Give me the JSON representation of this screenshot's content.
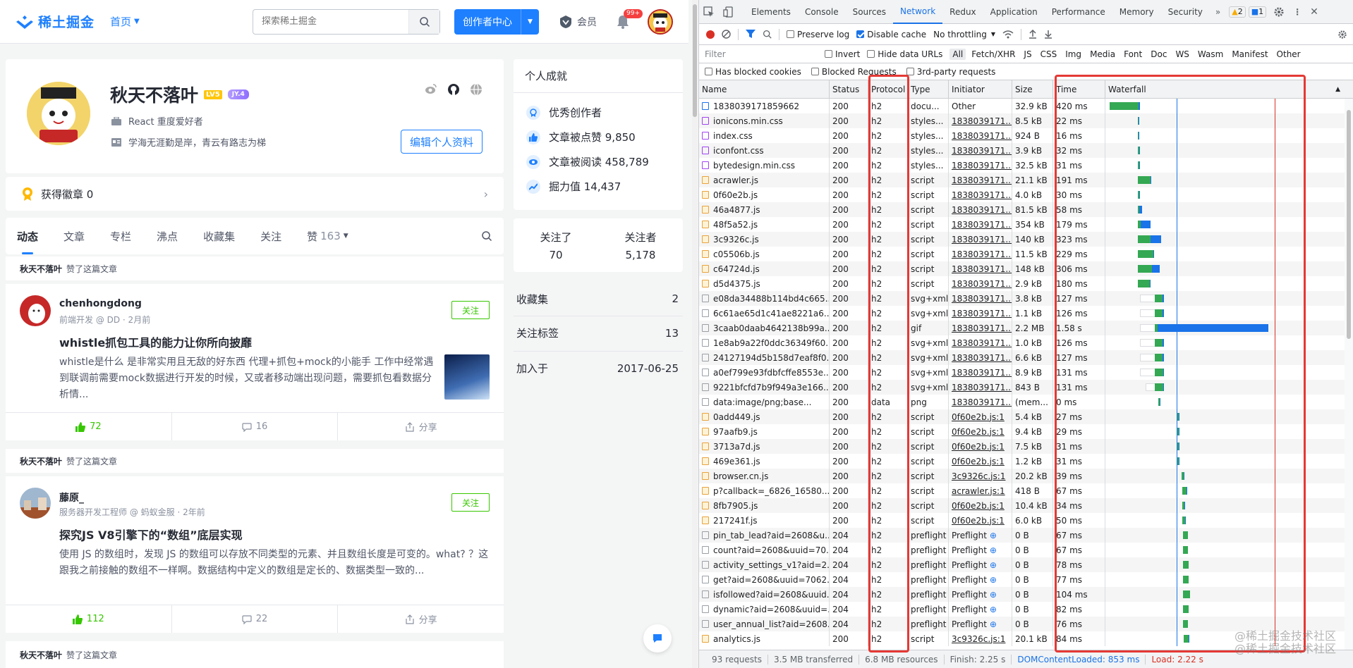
{
  "site": {
    "logo_text": "稀土掘金",
    "nav_home": "首页",
    "search_placeholder": "探索稀土掘金",
    "creator_btn": "创作者中心",
    "vip": "会员",
    "notif_badge": "99+",
    "brand_color": "#1e80ff"
  },
  "profile": {
    "name": "秋天不落叶",
    "level": "LV5",
    "jy": "JY.4",
    "title": "React 重度爱好者",
    "motto": "学海无涯勤是岸，青云有路志为梯",
    "edit_btn": "编辑个人资料",
    "badges_label": "获得徽章 0"
  },
  "tabs": [
    {
      "label": "动态"
    },
    {
      "label": "文章"
    },
    {
      "label": "专栏"
    },
    {
      "label": "沸点"
    },
    {
      "label": "收藏集"
    },
    {
      "label": "关注"
    },
    {
      "label": "赞",
      "count": "163"
    }
  ],
  "feed": [
    {
      "header_user": "秋天不落叶",
      "header_action": "赞了这篇文章",
      "author": "chenhongdong",
      "meta": "前端开发 @ DD · 2月前",
      "follow": "关注",
      "title": "whistle抓包工具的能力让你所向披靡",
      "body": "whistle是什么 是非常实用且无敌的好东西 代理+抓包+mock的小能手 工作中经常遇到联调前需要mock数据进行开发的时候，又或者移动端出现问题，需要抓包看数据分析情...",
      "likes": "72",
      "comments": "16",
      "share": "分享"
    },
    {
      "header_user": "秋天不落叶",
      "header_action": "赞了这篇文章",
      "author": "藤原_",
      "meta": "服务器开发工程师 @ 蚂蚁金服 · 2年前",
      "follow": "关注",
      "title": "探究JS V8引擎下的“数组”底层实现",
      "body": "使用 JS 的数组时，发现 JS 的数组可以存放不同类型的元素、并且数组长度是可变的。what? ？这跟我之前接触的数组不一样啊。数据结构中定义的数组是定长的、数据类型一致的...",
      "likes": "112",
      "comments": "22",
      "share": "分享"
    },
    {
      "header_user": "秋天不落叶",
      "header_action": "赞了这篇文章"
    }
  ],
  "achievements": {
    "title": "个人成就",
    "items": [
      {
        "text": "优秀创作者",
        "icon": "badge-icon"
      },
      {
        "text": "文章被点赞 9,850",
        "icon": "thumb-icon"
      },
      {
        "text": "文章被阅读 458,789",
        "icon": "eye-icon"
      },
      {
        "text": "掘力值 14,437",
        "icon": "trend-icon"
      }
    ]
  },
  "follows": {
    "following_label": "关注了",
    "following": "70",
    "followers_label": "关注者",
    "followers": "5,178"
  },
  "side_items": [
    {
      "label": "收藏集",
      "value": "2"
    },
    {
      "label": "关注标签",
      "value": "13"
    },
    {
      "label": "加入于",
      "value": "2017-06-25"
    }
  ],
  "devtools": {
    "tabs": [
      "Elements",
      "Console",
      "Sources",
      "Network",
      "Redux",
      "Application",
      "Performance",
      "Memory",
      "Security"
    ],
    "active_tab": "Network",
    "warnings": "2",
    "messages": "1",
    "toolbar": {
      "preserve_log": "Preserve log",
      "disable_cache": "Disable cache",
      "throttling": "No throttling"
    },
    "filter_placeholder": "Filter",
    "filter_opts": [
      "Invert",
      "Hide data URLs"
    ],
    "types": [
      "All",
      "Fetch/XHR",
      "JS",
      "CSS",
      "Img",
      "Media",
      "Font",
      "Doc",
      "WS",
      "Wasm",
      "Manifest",
      "Other"
    ],
    "block_opts": [
      "Has blocked cookies",
      "Blocked Requests",
      "3rd-party requests"
    ],
    "columns": [
      "Name",
      "Status",
      "Protocol",
      "Type",
      "Initiator",
      "Size",
      "Time",
      "Waterfall"
    ],
    "requests": [
      {
        "name": "1838039171859662",
        "status": "200",
        "proto": "h2",
        "type": "docu...",
        "init": "Other",
        "size": "32.9 kB",
        "time": "420 ms",
        "kind": "doc",
        "wf_start_ms": 0,
        "wf_green_ms": 400,
        "wf_blue_ms": 20
      },
      {
        "name": "ionicons.min.css",
        "status": "200",
        "proto": "h2",
        "type": "styles...",
        "init": "1838039171...",
        "size": "8.5 kB",
        "time": "22 ms",
        "kind": "css",
        "wf_start_ms": 390,
        "wf_green_ms": 12,
        "wf_blue_ms": 10
      },
      {
        "name": "index.css",
        "status": "200",
        "proto": "h2",
        "type": "styles...",
        "init": "1838039171...",
        "size": "924 B",
        "time": "16 ms",
        "kind": "css",
        "wf_start_ms": 390,
        "wf_green_ms": 10,
        "wf_blue_ms": 6
      },
      {
        "name": "iconfont.css",
        "status": "200",
        "proto": "h2",
        "type": "styles...",
        "init": "1838039171...",
        "size": "3.9 kB",
        "time": "32 ms",
        "kind": "css",
        "wf_start_ms": 390,
        "wf_green_ms": 22,
        "wf_blue_ms": 10
      },
      {
        "name": "bytedesign.min.css",
        "status": "200",
        "proto": "h2",
        "type": "styles...",
        "init": "1838039171...",
        "size": "32.5 kB",
        "time": "31 ms",
        "kind": "css",
        "wf_start_ms": 390,
        "wf_green_ms": 22,
        "wf_blue_ms": 9
      },
      {
        "name": "acrawler.js",
        "status": "200",
        "proto": "h2",
        "type": "script",
        "init": "1838039171...",
        "size": "21.1 kB",
        "time": "191 ms",
        "kind": "js",
        "wf_start_ms": 390,
        "wf_green_ms": 180,
        "wf_blue_ms": 11
      },
      {
        "name": "0f60e2b.js",
        "status": "200",
        "proto": "h2",
        "type": "script",
        "init": "1838039171...",
        "size": "4.0 kB",
        "time": "30 ms",
        "kind": "js",
        "wf_start_ms": 390,
        "wf_green_ms": 22,
        "wf_blue_ms": 8
      },
      {
        "name": "46a4877.js",
        "status": "200",
        "proto": "h2",
        "type": "script",
        "init": "1838039171...",
        "size": "81.5 kB",
        "time": "58 ms",
        "kind": "js",
        "wf_start_ms": 390,
        "wf_green_ms": 20,
        "wf_blue_ms": 38
      },
      {
        "name": "48f5a52.js",
        "status": "200",
        "proto": "h2",
        "type": "script",
        "init": "1838039171...",
        "size": "354 kB",
        "time": "179 ms",
        "kind": "js",
        "wf_start_ms": 390,
        "wf_green_ms": 40,
        "wf_blue_ms": 139
      },
      {
        "name": "3c9326c.js",
        "status": "200",
        "proto": "h2",
        "type": "script",
        "init": "1838039171...",
        "size": "140 kB",
        "time": "323 ms",
        "kind": "js",
        "wf_start_ms": 390,
        "wf_green_ms": 180,
        "wf_blue_ms": 143
      },
      {
        "name": "c05506b.js",
        "status": "200",
        "proto": "h2",
        "type": "script",
        "init": "1838039171...",
        "size": "11.5 kB",
        "time": "229 ms",
        "kind": "js",
        "wf_start_ms": 390,
        "wf_green_ms": 215,
        "wf_blue_ms": 14
      },
      {
        "name": "c64724d.js",
        "status": "200",
        "proto": "h2",
        "type": "script",
        "init": "1838039171...",
        "size": "148 kB",
        "time": "306 ms",
        "kind": "js",
        "wf_start_ms": 390,
        "wf_green_ms": 200,
        "wf_blue_ms": 106
      },
      {
        "name": "d5d4375.js",
        "status": "200",
        "proto": "h2",
        "type": "script",
        "init": "1838039171...",
        "size": "2.9 kB",
        "time": "180 ms",
        "kind": "js",
        "wf_start_ms": 390,
        "wf_green_ms": 170,
        "wf_blue_ms": 10
      },
      {
        "name": "e08da34488b114bd4c665...",
        "status": "200",
        "proto": "h2",
        "type": "svg+xml",
        "init": "1838039171...",
        "size": "3.8 kB",
        "time": "127 ms",
        "kind": "img",
        "wf_start_ms": 420,
        "wf_wait_ms": 210,
        "wf_green_ms": 110,
        "wf_blue_ms": 17
      },
      {
        "name": "6c61ae65d1c41ae8221a6...",
        "status": "200",
        "proto": "h2",
        "type": "svg+xml",
        "init": "1838039171...",
        "size": "1.1 kB",
        "time": "126 ms",
        "kind": "img",
        "wf_start_ms": 420,
        "wf_wait_ms": 210,
        "wf_green_ms": 110,
        "wf_blue_ms": 16
      },
      {
        "name": "3caab0daab4642138b99a...",
        "status": "200",
        "proto": "h2",
        "type": "gif",
        "init": "1838039171...",
        "size": "2.2 MB",
        "time": "1.58 s",
        "kind": "img",
        "wf_start_ms": 420,
        "wf_wait_ms": 210,
        "wf_green_ms": 40,
        "wf_blue_ms": 1540
      },
      {
        "name": "1e8ab9a22f0ddc36349f60...",
        "status": "200",
        "proto": "h2",
        "type": "svg+xml",
        "init": "1838039171...",
        "size": "1.0 kB",
        "time": "126 ms",
        "kind": "img",
        "wf_start_ms": 420,
        "wf_wait_ms": 210,
        "wf_green_ms": 110,
        "wf_blue_ms": 16
      },
      {
        "name": "24127194d5b158d7eaf8f0...",
        "status": "200",
        "proto": "h2",
        "type": "svg+xml",
        "init": "1838039171...",
        "size": "6.6 kB",
        "time": "127 ms",
        "kind": "img",
        "wf_start_ms": 420,
        "wf_wait_ms": 210,
        "wf_green_ms": 110,
        "wf_blue_ms": 17
      },
      {
        "name": "a0ef799e93fdbfcffe8553e...",
        "status": "200",
        "proto": "h2",
        "type": "svg+xml",
        "init": "1838039171...",
        "size": "8.9 kB",
        "time": "131 ms",
        "kind": "img",
        "wf_start_ms": 420,
        "wf_wait_ms": 210,
        "wf_green_ms": 114,
        "wf_blue_ms": 17
      },
      {
        "name": "9221bfcfd7b9f949a3e166...",
        "status": "200",
        "proto": "h2",
        "type": "svg+xml",
        "init": "1838039171...",
        "size": "843 B",
        "time": "131 ms",
        "kind": "img",
        "wf_start_ms": 500,
        "wf_wait_ms": 130,
        "wf_green_ms": 114,
        "wf_blue_ms": 17
      },
      {
        "name": "data:image/png;base...",
        "status": "200",
        "proto": "data",
        "type": "png",
        "init": "1838039171...",
        "size": "(mem...",
        "time": "0 ms",
        "kind": "img",
        "wf_start_ms": 680,
        "wf_green_ms": 0,
        "wf_blue_ms": 8
      },
      {
        "name": "0add449.js",
        "status": "200",
        "proto": "h2",
        "type": "script",
        "init": "0f60e2b.js:1",
        "size": "5.4 kB",
        "time": "27 ms",
        "kind": "js",
        "wf_start_ms": 940,
        "wf_green_ms": 22,
        "wf_blue_ms": 5
      },
      {
        "name": "97aafb9.js",
        "status": "200",
        "proto": "h2",
        "type": "script",
        "init": "0f60e2b.js:1",
        "size": "9.4 kB",
        "time": "29 ms",
        "kind": "js",
        "wf_start_ms": 940,
        "wf_green_ms": 24,
        "wf_blue_ms": 5
      },
      {
        "name": "3713a7d.js",
        "status": "200",
        "proto": "h2",
        "type": "script",
        "init": "0f60e2b.js:1",
        "size": "7.5 kB",
        "time": "31 ms",
        "kind": "js",
        "wf_start_ms": 940,
        "wf_green_ms": 26,
        "wf_blue_ms": 5
      },
      {
        "name": "469e361.js",
        "status": "200",
        "proto": "h2",
        "type": "script",
        "init": "0f60e2b.js:1",
        "size": "1.2 kB",
        "time": "31 ms",
        "kind": "js",
        "wf_start_ms": 940,
        "wf_green_ms": 27,
        "wf_blue_ms": 4
      },
      {
        "name": "browser.cn.js",
        "status": "200",
        "proto": "h2",
        "type": "script",
        "init": "3c9326c.js:1",
        "size": "20.2 kB",
        "time": "39 ms",
        "kind": "js",
        "wf_start_ms": 1000,
        "wf_green_ms": 34,
        "wf_blue_ms": 5
      },
      {
        "name": "p?callback=_6826_16580...",
        "status": "200",
        "proto": "h2",
        "type": "script",
        "init": "acrawler.js:1",
        "size": "418 B",
        "time": "67 ms",
        "kind": "js",
        "wf_start_ms": 1010,
        "wf_green_ms": 60,
        "wf_blue_ms": 7
      },
      {
        "name": "8fb7905.js",
        "status": "200",
        "proto": "h2",
        "type": "script",
        "init": "0f60e2b.js:1",
        "size": "10.4 kB",
        "time": "34 ms",
        "kind": "js",
        "wf_start_ms": 1010,
        "wf_green_ms": 29,
        "wf_blue_ms": 5
      },
      {
        "name": "217241f.js",
        "status": "200",
        "proto": "h2",
        "type": "script",
        "init": "0f60e2b.js:1",
        "size": "6.0 kB",
        "time": "50 ms",
        "kind": "js",
        "wf_start_ms": 1010,
        "wf_green_ms": 45,
        "wf_blue_ms": 5
      },
      {
        "name": "pin_tab_lead?aid=2608&u...",
        "status": "204",
        "proto": "h2",
        "type": "preflight",
        "init": "Preflight",
        "size": "0 B",
        "time": "67 ms",
        "kind": "other",
        "wf_start_ms": 1020,
        "wf_green_ms": 67,
        "wf_blue_ms": 0
      },
      {
        "name": "count?aid=2608&uuid=70...",
        "status": "204",
        "proto": "h2",
        "type": "preflight",
        "init": "Preflight",
        "size": "0 B",
        "time": "67 ms",
        "kind": "other",
        "wf_start_ms": 1020,
        "wf_green_ms": 67,
        "wf_blue_ms": 0
      },
      {
        "name": "activity_settings_v1?aid=2...",
        "status": "204",
        "proto": "h2",
        "type": "preflight",
        "init": "Preflight",
        "size": "0 B",
        "time": "78 ms",
        "kind": "other",
        "wf_start_ms": 1020,
        "wf_green_ms": 78,
        "wf_blue_ms": 0
      },
      {
        "name": "get?aid=2608&uuid=7062...",
        "status": "204",
        "proto": "h2",
        "type": "preflight",
        "init": "Preflight",
        "size": "0 B",
        "time": "77 ms",
        "kind": "other",
        "wf_start_ms": 1020,
        "wf_green_ms": 77,
        "wf_blue_ms": 0
      },
      {
        "name": "isfollowed?aid=2608&uuid...",
        "status": "204",
        "proto": "h2",
        "type": "preflight",
        "init": "Preflight",
        "size": "0 B",
        "time": "104 ms",
        "kind": "other",
        "wf_start_ms": 1020,
        "wf_green_ms": 104,
        "wf_blue_ms": 0
      },
      {
        "name": "dynamic?aid=2608&uuid=...",
        "status": "204",
        "proto": "h2",
        "type": "preflight",
        "init": "Preflight",
        "size": "0 B",
        "time": "82 ms",
        "kind": "other",
        "wf_start_ms": 1020,
        "wf_green_ms": 82,
        "wf_blue_ms": 0
      },
      {
        "name": "user_annual_list?aid=2608...",
        "status": "204",
        "proto": "h2",
        "type": "preflight",
        "init": "Preflight",
        "size": "0 B",
        "time": "76 ms",
        "kind": "other",
        "wf_start_ms": 1020,
        "wf_green_ms": 76,
        "wf_blue_ms": 0
      },
      {
        "name": "analytics.js",
        "status": "200",
        "proto": "h2",
        "type": "script",
        "init": "3c9326c.js:1",
        "size": "20.1 kB",
        "time": "84 ms",
        "kind": "js",
        "wf_start_ms": 1030,
        "wf_green_ms": 70,
        "wf_blue_ms": 14
      }
    ],
    "status": {
      "requests": "93 requests",
      "transferred": "3.5 MB transferred",
      "resources": "6.8 MB resources",
      "finish": "Finish: 2.25 s",
      "dcl": "DOMContentLoaded: 853 ms",
      "load": "Load: 2.22 s"
    },
    "wf_total_ms": 2300,
    "dcl_ms": 853,
    "load_ms": 2220,
    "watermark": [
      "@稀土掘金技术社区",
      "@稀土掘金技术社区"
    ]
  }
}
